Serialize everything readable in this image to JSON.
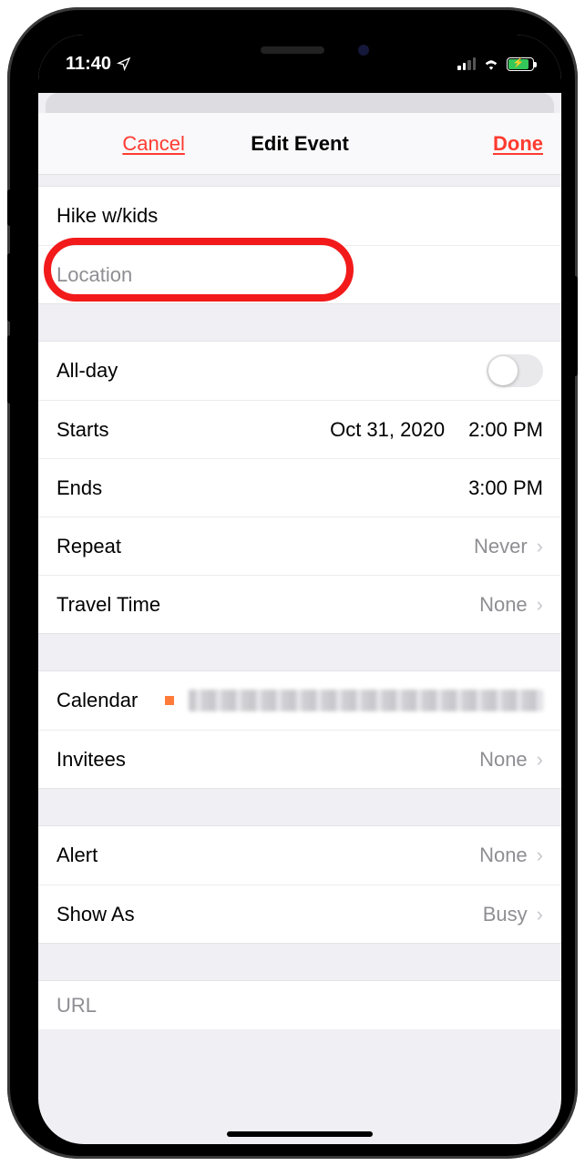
{
  "statusbar": {
    "time": "11:40"
  },
  "header": {
    "cancel": "Cancel",
    "title": "Edit Event",
    "done": "Done"
  },
  "event": {
    "title": "Hike w/kids",
    "location_placeholder": "Location",
    "location_value": ""
  },
  "time": {
    "allday_label": "All-day",
    "allday_on": false,
    "starts_label": "Starts",
    "starts_date": "Oct 31, 2020",
    "starts_time": "2:00 PM",
    "ends_label": "Ends",
    "ends_time": "3:00 PM",
    "repeat_label": "Repeat",
    "repeat_value": "Never",
    "travel_label": "Travel Time",
    "travel_value": "None"
  },
  "calendar": {
    "label": "Calendar",
    "invitees_label": "Invitees",
    "invitees_value": "None"
  },
  "alert": {
    "alert_label": "Alert",
    "alert_value": "None",
    "showas_label": "Show As",
    "showas_value": "Busy"
  },
  "url": {
    "placeholder": "URL"
  }
}
